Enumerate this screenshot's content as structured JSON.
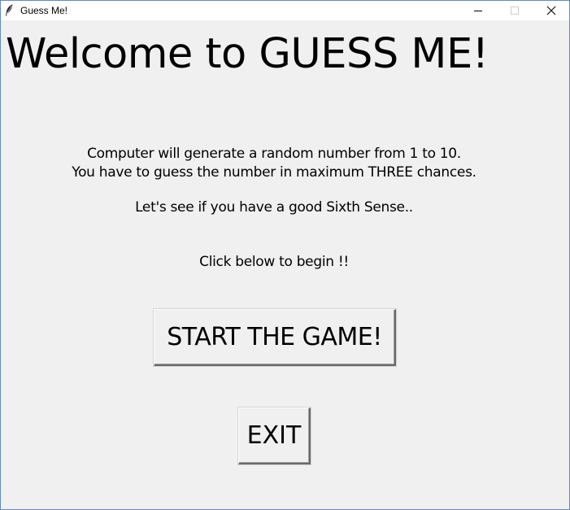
{
  "window": {
    "title": "Guess Me!",
    "icon": "feather-icon",
    "controls": [
      "minimize-icon",
      "maximize-icon",
      "close-icon"
    ]
  },
  "main": {
    "heading": "Welcome to GUESS ME!",
    "instructions": [
      "Computer will generate a random number from 1 to 10.",
      "You have to guess the number in maximum THREE chances.",
      "Let's see if you have a good Sixth Sense..",
      "Click below to begin !!"
    ],
    "start_button_label": "START THE GAME!",
    "exit_button_label": "EXIT"
  },
  "colors": {
    "background": "#f0f0f0",
    "titlebar": "#ffffff",
    "window_border": "#5f8bbf",
    "text": "#000000"
  }
}
